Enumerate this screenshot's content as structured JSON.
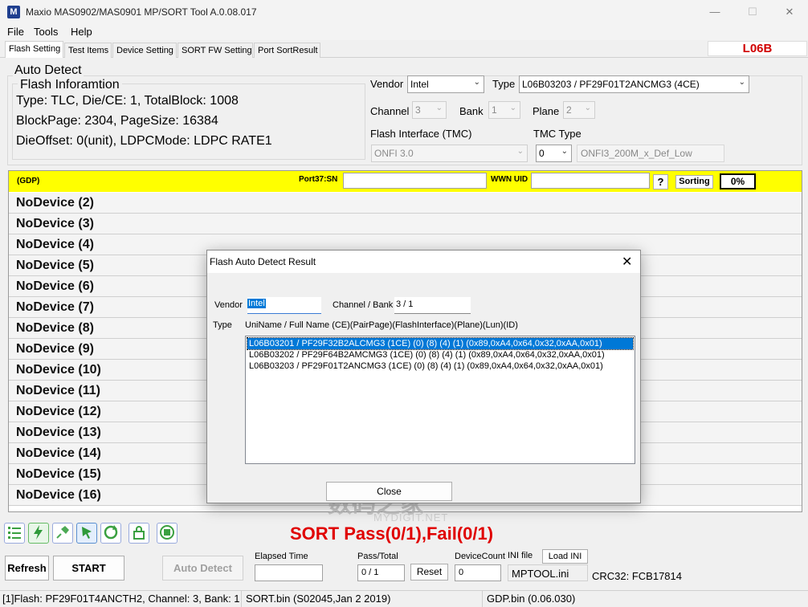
{
  "window": {
    "title": "Maxio MAS0902/MAS0901 MP/SORT Tool A.0.08.017",
    "icon_letter": "M",
    "minimize": "—",
    "maximize": "☐",
    "close": "✕"
  },
  "menu": [
    "File",
    "Tools",
    "Help"
  ],
  "tabs": [
    "Flash Setting",
    "Test Items",
    "Device Setting",
    "SORT FW Setting",
    "Port SortResult"
  ],
  "model_code": "L06B",
  "auto_detect": {
    "group_title": "Auto Detect",
    "flash_info_title": "Flash Inforamtion",
    "info_lines": [
      "Type: TLC, Die/CE: 1, TotalBlock: 1008",
      "BlockPage: 2304, PageSize: 16384",
      "DieOffset: 0(unit), LDPCMode: LDPC RATE1"
    ],
    "vendor_label": "Vendor",
    "vendor_value": "Intel",
    "type_label": "Type",
    "type_value": "L06B03203  /  PF29F01T2ANCMG3 (4CE)",
    "channel_label": "Channel",
    "channel_value": "3",
    "bank_label": "Bank",
    "bank_value": "1",
    "plane_label": "Plane",
    "plane_value": "2",
    "flash_interface_label": "Flash Interface (TMC)",
    "flash_interface_value": "ONFI 3.0",
    "tmc_type_label": "TMC Type",
    "tmc_type_value": "0",
    "tmc_mode_value": "ONFI3_200M_x_Def_Low"
  },
  "port_panel": {
    "gdp_label": "(GDP)",
    "sn_label": "Port37:SN",
    "sn_value": "",
    "wwn_label": "WWN UID",
    "wwn_value": "",
    "help_button": "?",
    "sorting_button": "Sorting",
    "progress": "0%",
    "devices": [
      "NoDevice (2)",
      "NoDevice (3)",
      "NoDevice (4)",
      "NoDevice (5)",
      "NoDevice (6)",
      "NoDevice (7)",
      "NoDevice (8)",
      "NoDevice (9)",
      "NoDevice (10)",
      "NoDevice (11)",
      "NoDevice (12)",
      "NoDevice (13)",
      "NoDevice (14)",
      "NoDevice (15)",
      "NoDevice (16)"
    ]
  },
  "toolbar_icons": [
    "list-icon",
    "lightning-icon",
    "pin-icon",
    "cursor-icon",
    "refresh-cycle-icon",
    "lock-icon",
    "stop-icon"
  ],
  "sort_result": "SORT  Pass(0/1),Fail(0/1)",
  "bottom": {
    "refresh_button": "Refresh",
    "start_button": "START",
    "auto_detect_button": "Auto Detect",
    "elapsed_label": "Elapsed Time",
    "elapsed_value": "",
    "pass_total_label": "Pass/Total",
    "pass_total_value": "0 / 1",
    "reset_button": "Reset",
    "device_count_label": "DeviceCount",
    "device_count_value": "0",
    "ini_label": "INI file",
    "load_ini_button": "Load INI",
    "ini_value": "MPTOOL.ini",
    "crc": "CRC32: FCB17814"
  },
  "status": {
    "flash": "[1]Flash: PF29F01T4ANCTH2, Channel: 3, Bank: 1",
    "sort_bin": "SORT.bin (S02045,Jan  2 2019)",
    "gdp_bin": "GDP.bin (0.06.030)"
  },
  "dialog": {
    "title": "Flash Auto Detect Result",
    "close_x": "✕",
    "vendor_label": "Vendor",
    "vendor_value": "Intel",
    "channel_bank_label": "Channel / Bank",
    "channel_bank_value": "3 / 1",
    "type_label": "Type",
    "columns_header": "UniName / Full Name (CE)(PairPage)(FlashInterface)(Plane)(Lun)(ID)",
    "rows": [
      "L06B03201  /  PF29F32B2ALCMG3 (1CE) (0) (8) (4) (1) (0x89,0xA4,0x64,0x32,0xAA,0x01)",
      "L06B03202  /  PF29F64B2AMCMG3 (1CE) (0) (8) (4) (1) (0x89,0xA4,0x64,0x32,0xAA,0x01)",
      "L06B03203  /  PF29F01T2ANCMG3 (1CE) (0) (8) (4) (1) (0x89,0xA4,0x64,0x32,0xAA,0x01)"
    ],
    "selected_row": 0,
    "close_button": "Close"
  },
  "watermark": {
    "text": "数码之家",
    "sub": "MYDIGIT.NET"
  }
}
